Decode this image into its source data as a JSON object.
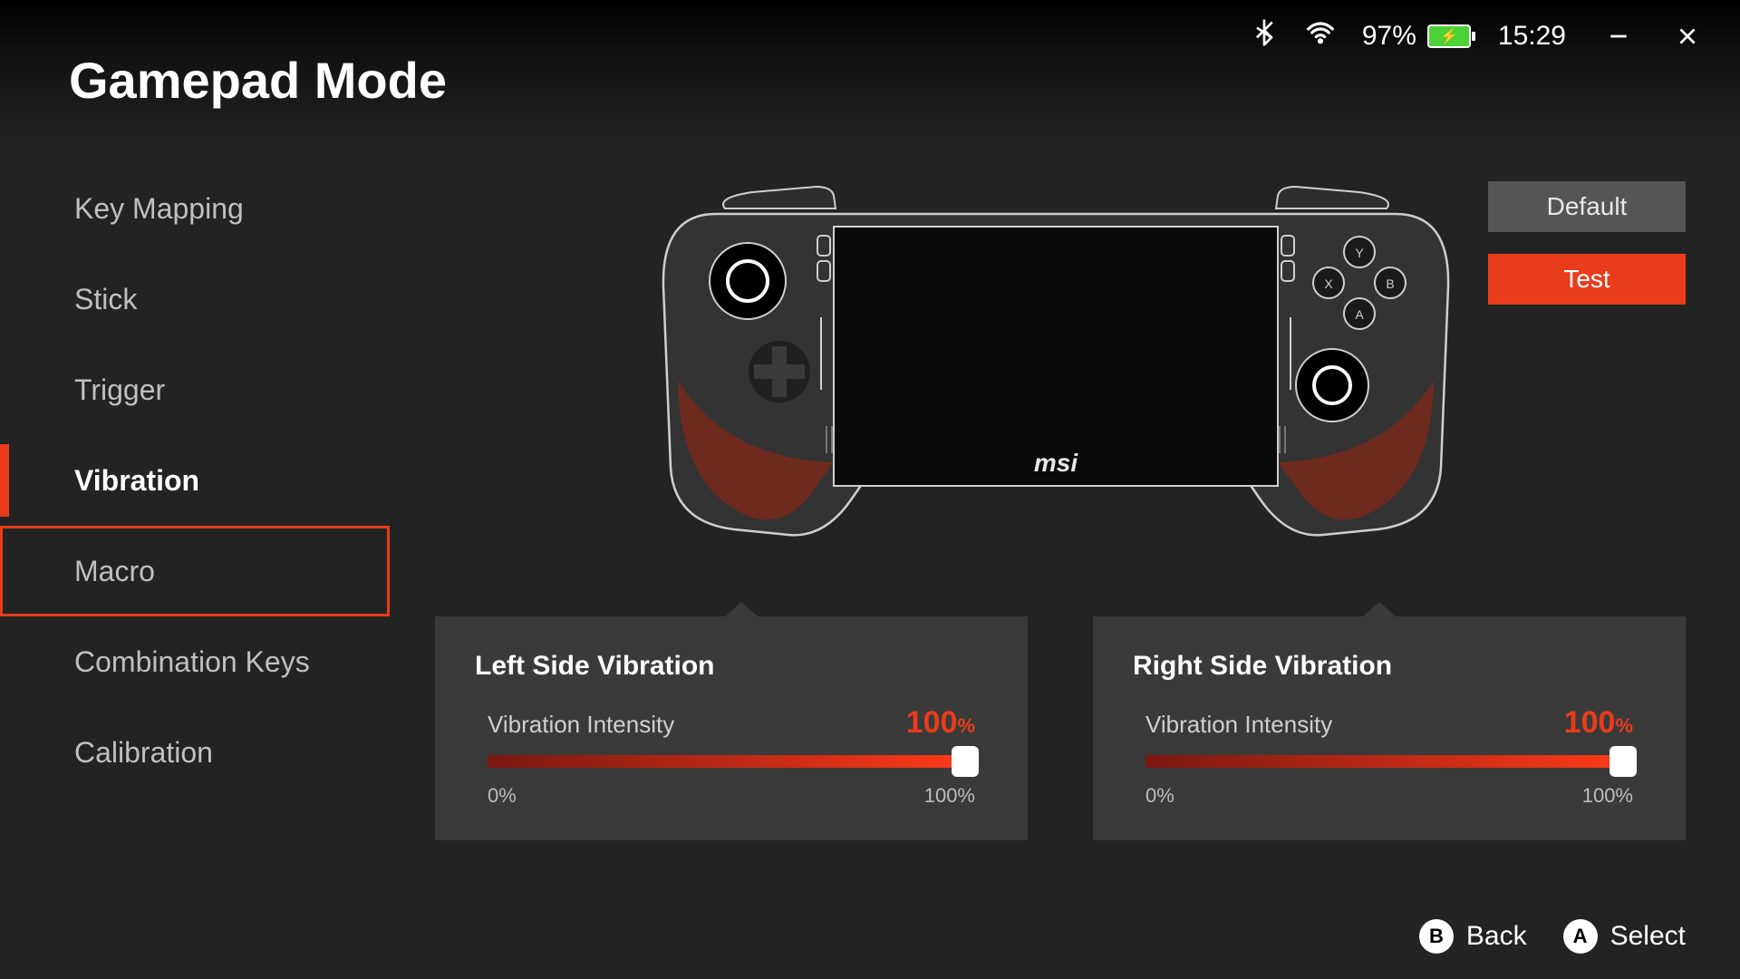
{
  "header": {
    "title": "Gamepad Mode",
    "battery_percent": "97%",
    "time": "15:29"
  },
  "sidebar": {
    "items": [
      {
        "label": "Key Mapping"
      },
      {
        "label": "Stick"
      },
      {
        "label": "Trigger"
      },
      {
        "label": "Vibration"
      },
      {
        "label": "Macro"
      },
      {
        "label": "Combination Keys"
      },
      {
        "label": "Calibration"
      }
    ]
  },
  "device": {
    "brand": "msi"
  },
  "actions": {
    "default_label": "Default",
    "test_label": "Test"
  },
  "vibration": {
    "left": {
      "title": "Left Side Vibration",
      "intensity_label": "Vibration Intensity",
      "value": "100",
      "pct": "%",
      "min_label": "0%",
      "max_label": "100%"
    },
    "right": {
      "title": "Right Side Vibration",
      "intensity_label": "Vibration Intensity",
      "value": "100",
      "pct": "%",
      "min_label": "0%",
      "max_label": "100%"
    }
  },
  "footer": {
    "back_key": "B",
    "back_label": "Back",
    "select_key": "A",
    "select_label": "Select"
  }
}
